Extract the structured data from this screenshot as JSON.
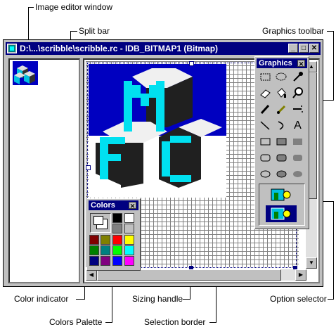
{
  "callouts": {
    "image_editor_window": "Image editor window",
    "split_bar": "Split bar",
    "graphics_toolbar": "Graphics toolbar",
    "color_indicator": "Color indicator",
    "colors_palette": "Colors Palette",
    "sizing_handle": "Sizing handle",
    "selection_border": "Selection border",
    "option_selector": "Option selector"
  },
  "window": {
    "title": "D:\\...\\scribble\\scribble.rc - IDB_BITMAP1 (Bitmap)",
    "minimize": "_",
    "maximize": "□",
    "close": "✕"
  },
  "graphics_palette": {
    "title": "Graphics",
    "close": "✕",
    "tools": [
      "rect-select",
      "lasso-select",
      "pick-color",
      "erase",
      "fill",
      "magnify",
      "pencil",
      "brush",
      "airbrush",
      "line",
      "curve",
      "text",
      "rectangle",
      "filled-rect",
      "solid-rect",
      "round-rect",
      "filled-round-rect",
      "solid-round-rect",
      "ellipse",
      "filled-ellipse",
      "solid-ellipse"
    ],
    "text_tool_glyph": "A"
  },
  "colors_palette": {
    "title": "Colors",
    "close": "✕",
    "swatches": [
      "#000000",
      "#808080",
      "#800000",
      "#808000",
      "#008000",
      "#008080",
      "#000080",
      "#800080",
      "#ffffff",
      "#c0c0c0",
      "#ff0000",
      "#ffff00",
      "#00ff00",
      "#00ffff",
      "#0000ff",
      "#ff00ff"
    ]
  },
  "bitmap": {
    "background": "#0000c0",
    "letter_color": "#00e0f0",
    "dark_color": "#202020",
    "light_color": "#f0f0f0"
  }
}
